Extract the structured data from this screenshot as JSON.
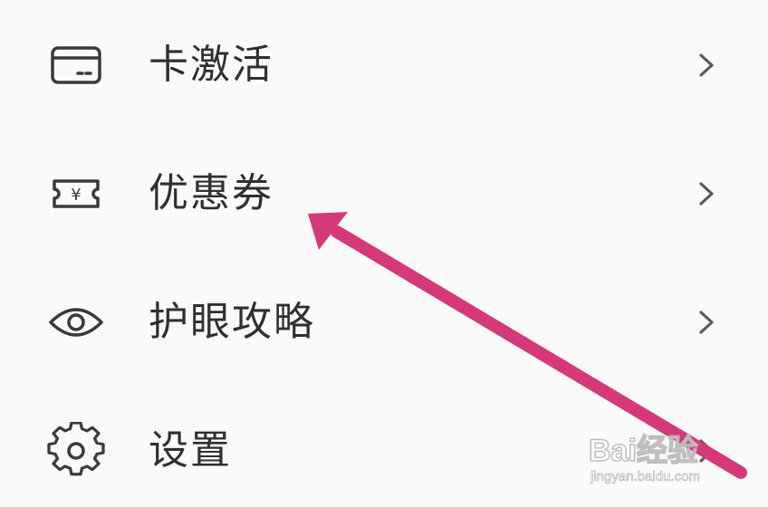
{
  "menu": {
    "items": [
      {
        "label": "卡激活",
        "icon": "card-icon"
      },
      {
        "label": "优惠券",
        "icon": "coupon-icon"
      },
      {
        "label": "护眼攻略",
        "icon": "eye-icon"
      },
      {
        "label": "设置",
        "icon": "gear-icon"
      }
    ]
  },
  "colors": {
    "text": "#2f2f2f",
    "icon": "#3a3a3a",
    "chevron": "#5a5a5a",
    "arrow": "#d6397a",
    "background": "#fafafa"
  },
  "watermark": {
    "logo": "Bai经验",
    "url": "jingyan.baidu.com"
  }
}
